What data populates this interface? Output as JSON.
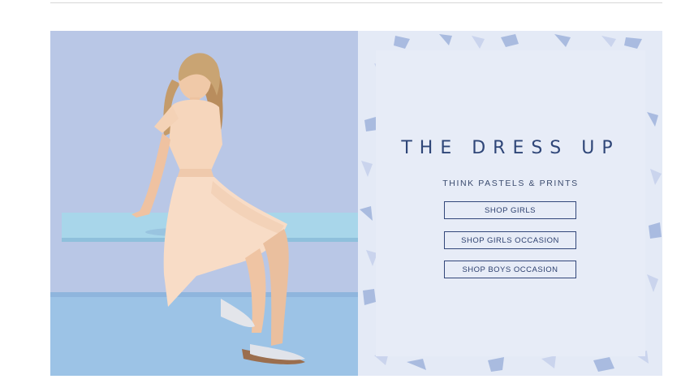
{
  "banner": {
    "headline": "THE DRESS UP",
    "subheadline": "THINK PASTELS & PRINTS",
    "buttons": [
      {
        "label": "SHOP GIRLS"
      },
      {
        "label": "SHOP GIRLS OCCASION"
      },
      {
        "label": "SHOP BOYS OCCASION"
      }
    ]
  },
  "colors": {
    "accent": "#2f4678",
    "panel": "#e7ecf7",
    "terrazzo": [
      "#9fb3dc",
      "#c7d2ec",
      "#b2c2e4",
      "#d7dff1"
    ]
  }
}
